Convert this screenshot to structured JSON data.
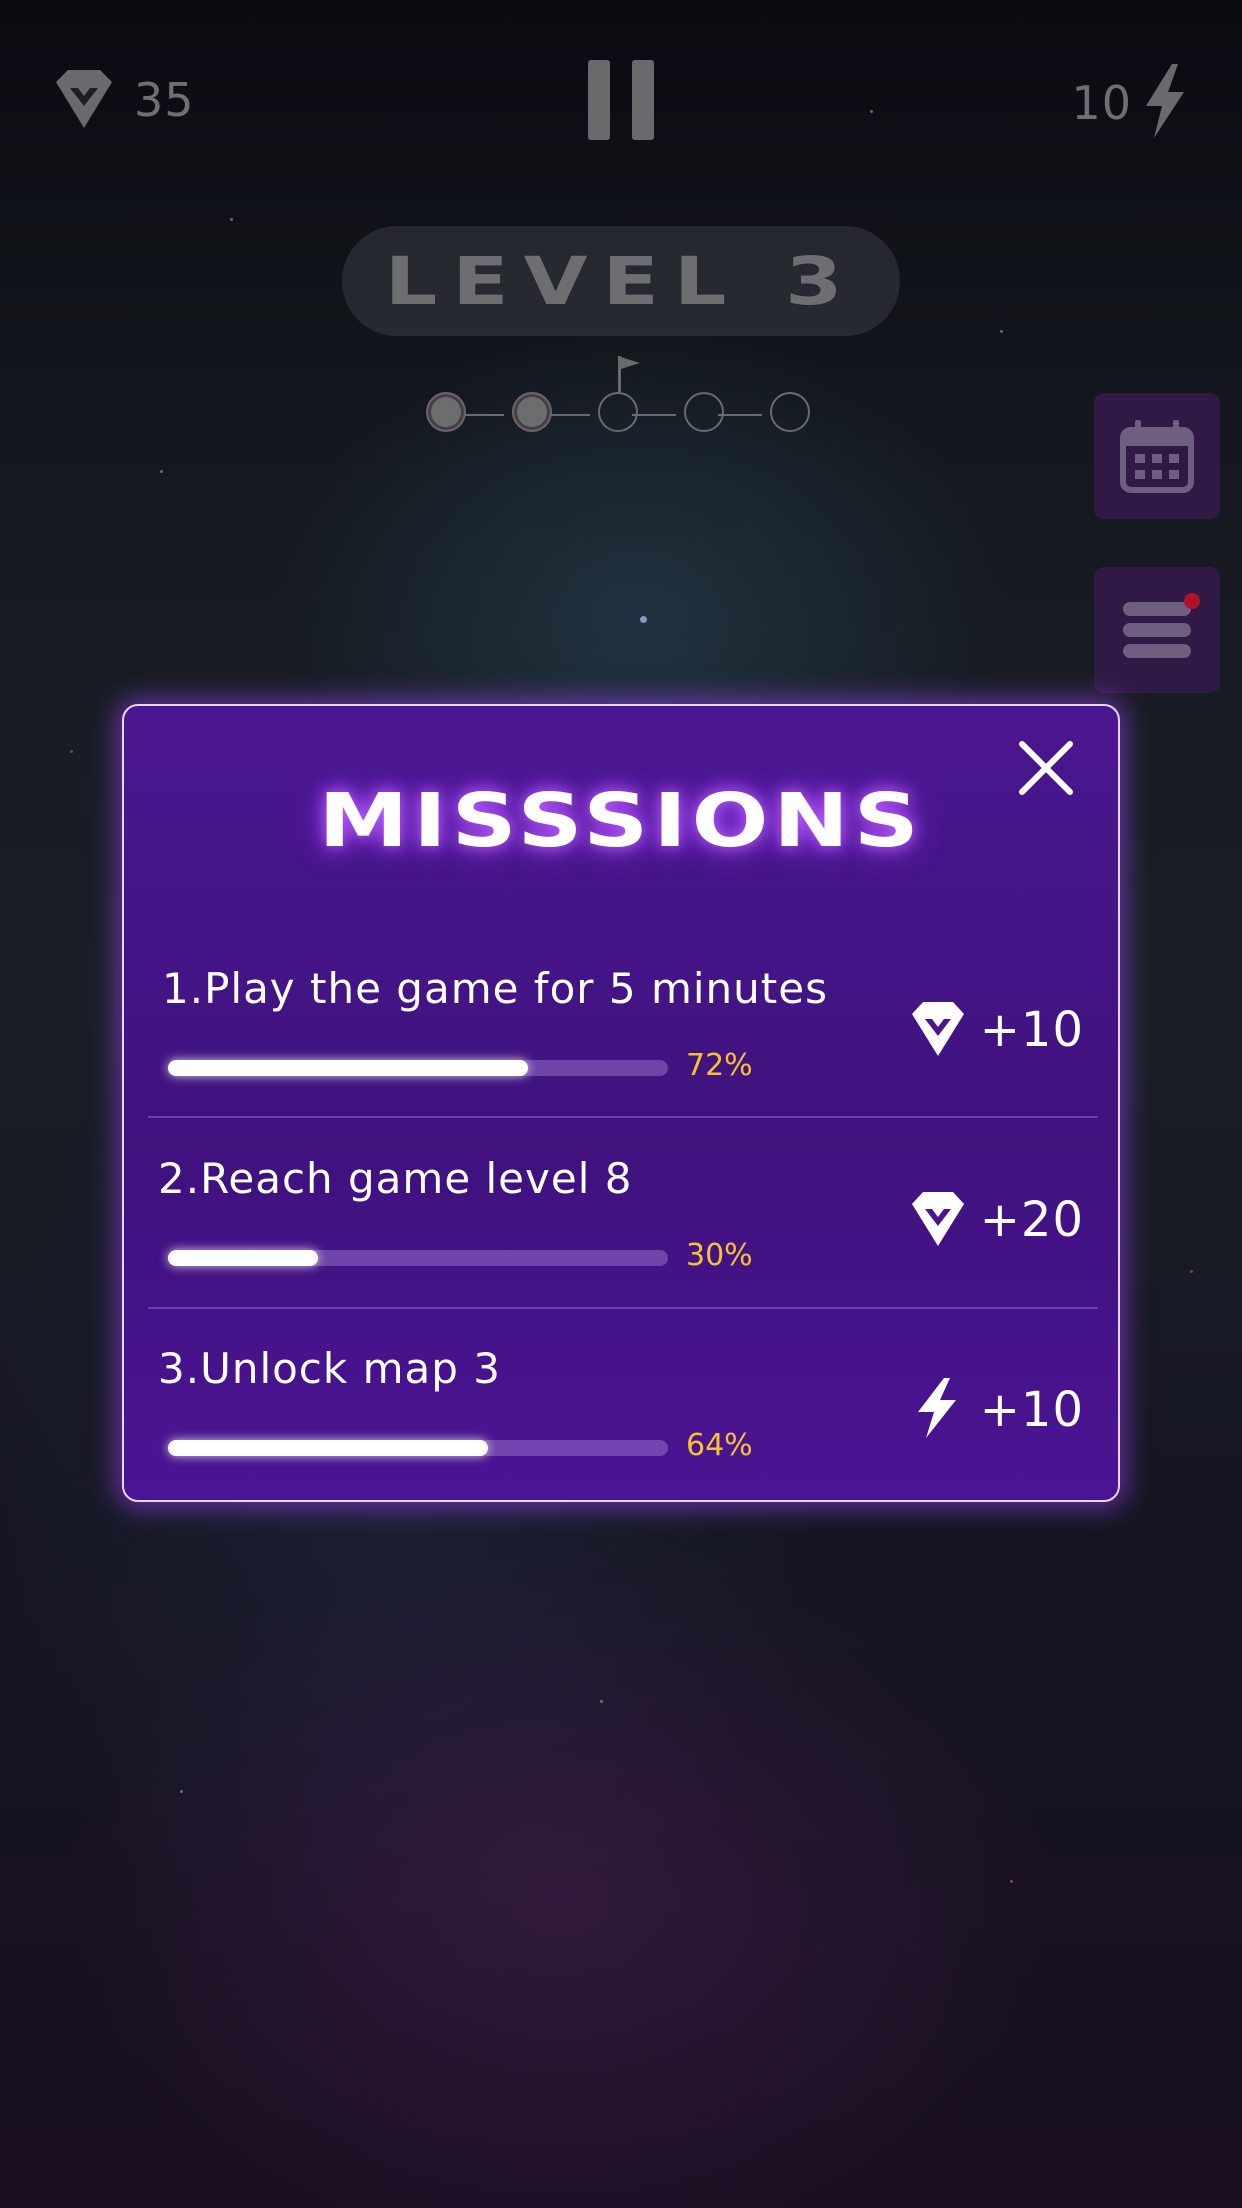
{
  "hud": {
    "gems": "35",
    "energy": "10",
    "icons": {
      "gems": "gem-icon",
      "energy": "lightning-icon",
      "pause": "pause-icon"
    }
  },
  "level": {
    "label": "LEVEL 3",
    "progress_steps": 5,
    "completed_steps": 2,
    "flag_step": 3
  },
  "side_buttons": [
    {
      "icon": "calendar-icon"
    },
    {
      "icon": "list-icon",
      "notification": true
    }
  ],
  "missions_modal": {
    "title": "MISSSIONS",
    "close_icon": "close-icon",
    "items": [
      {
        "number": "1.",
        "text": "Play the game for 5 minutes",
        "progress": 72,
        "progress_label": "72%",
        "reward_icon": "gem-icon",
        "reward": "+10"
      },
      {
        "number": "2.",
        "text": "Reach game level 8",
        "progress": 30,
        "progress_label": "30%",
        "reward_icon": "gem-icon",
        "reward": "+20"
      },
      {
        "number": "3.",
        "text": "Unlock map 3",
        "progress": 64,
        "progress_label": "64%",
        "reward_icon": "lightning-icon",
        "reward": "+10"
      }
    ]
  },
  "colors": {
    "modal_bg": "#43148a",
    "modal_border": "#e8d6ff",
    "progress_text": "#f7c230",
    "notification": "#b1122a"
  }
}
